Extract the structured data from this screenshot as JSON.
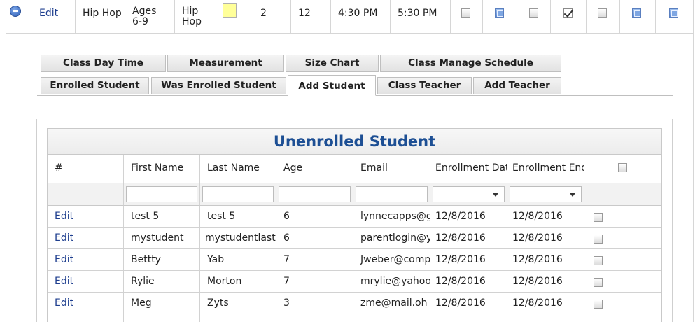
{
  "class_row": {
    "edit_label": "Edit",
    "class_name": "Hip Hop",
    "age_group": "Ages 6-9",
    "style": "Hip Hop",
    "swatch_color": "#ffff99",
    "value_1": "2",
    "value_2": "12",
    "start_time": "4:30 PM",
    "end_time": "5:30 PM",
    "checkboxes": [
      "unchecked",
      "blue",
      "unchecked",
      "checked",
      "unchecked",
      "blue",
      "blue"
    ]
  },
  "tabs": {
    "row1": [
      "Class Day Time",
      "Measurement",
      "Size Chart",
      "Class Manage Schedule"
    ],
    "row2": [
      "Enrolled Student",
      "Was Enrolled Student",
      "Add Student",
      "Class Teacher",
      "Add Teacher"
    ],
    "active": "Add Student"
  },
  "grid": {
    "title": "Unenrolled Student",
    "title_color": "#1d4f94",
    "columns": [
      "#",
      "First Name",
      "Last Name",
      "Age",
      "Email",
      "Enrollment Dat",
      "Enrollment End"
    ],
    "rows": [
      {
        "action": "Edit",
        "first": "test 5",
        "last": "test 5",
        "age": "6",
        "email": "lynnecapps@gr",
        "start": "12/8/2016",
        "end": "12/8/2016"
      },
      {
        "action": "Edit",
        "first": "mystudent",
        "last": "mystudentlast",
        "age": "6",
        "email": "parentlogin@ya",
        "start": "12/8/2016",
        "end": "12/8/2016"
      },
      {
        "action": "Edit",
        "first": "Bettty",
        "last": "Yab",
        "age": "7",
        "email": "Jweber@compu",
        "start": "12/8/2016",
        "end": "12/8/2016"
      },
      {
        "action": "Edit",
        "first": "Rylie",
        "last": "Morton",
        "age": "7",
        "email": "mrylie@yahoo.",
        "start": "12/8/2016",
        "end": "12/8/2016"
      },
      {
        "action": "Edit",
        "first": "Meg",
        "last": "Zyts",
        "age": "3",
        "email": "zme@mail.oh",
        "start": "12/8/2016",
        "end": "12/8/2016"
      }
    ]
  },
  "link_color": "#1f3f8f"
}
